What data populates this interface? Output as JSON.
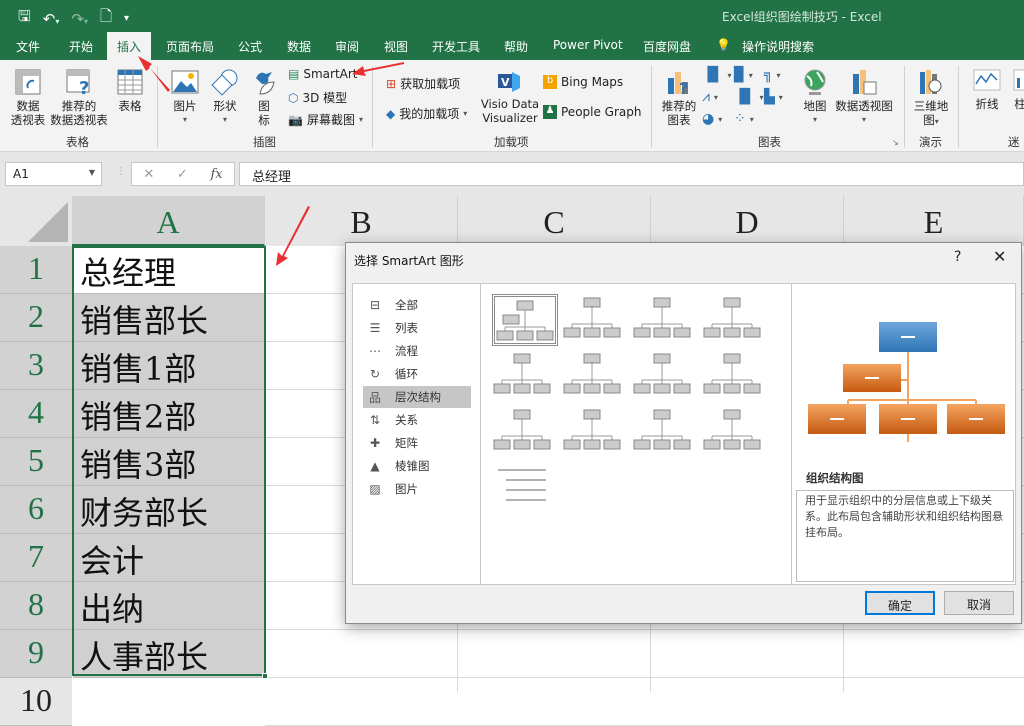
{
  "window": {
    "title": "Excel组织图绘制技巧  -  Excel"
  },
  "qat": {
    "save": "save-icon",
    "undo": "undo-icon",
    "redo": "redo-icon",
    "preview": "print-preview-icon",
    "customize": "customize-icon"
  },
  "tabs": [
    "文件",
    "开始",
    "插入",
    "页面布局",
    "公式",
    "数据",
    "审阅",
    "视图",
    "开发工具",
    "帮助",
    "Power Pivot",
    "百度网盘"
  ],
  "active_tab": "插入",
  "tell_me": "操作说明搜索",
  "ribbon": {
    "tables": {
      "label": "表格",
      "pivot": "数据\n透视表",
      "pivot1": "数据",
      "pivot2": "透视表",
      "recpivot1": "推荐的",
      "recpivot2": "数据透视表",
      "table": "表格"
    },
    "illustrations": {
      "label": "插图",
      "pictures": "图片",
      "shapes": "形状",
      "icons1": "图",
      "icons2": "标",
      "smartart": "SmartArt",
      "model3d": "3D 模型",
      "screenshot": "屏幕截图"
    },
    "addins": {
      "label": "加载项",
      "get": "获取加载项",
      "my": "我的加载项",
      "visio1": "Visio Data",
      "visio2": "Visualizer",
      "bing": "Bing Maps",
      "people": "People Graph"
    },
    "charts": {
      "label": "图表",
      "rec1": "推荐的",
      "rec2": "图表",
      "map": "地图",
      "pivotchart": "数据透视图"
    },
    "tours": {
      "label": "演示",
      "map3d1": "三维地",
      "map3d2": "图"
    },
    "sparklines": {
      "label": "迷你",
      "line": "折线",
      "column": "柱"
    }
  },
  "formula_bar": {
    "name_box": "A1",
    "cancel": "✕",
    "enter": "✓",
    "fx": "fx",
    "value": "总经理"
  },
  "sheet": {
    "columns": [
      "A",
      "B",
      "C",
      "D",
      "E"
    ],
    "rows": [
      "1",
      "2",
      "3",
      "4",
      "5",
      "6",
      "7",
      "8",
      "9",
      "10"
    ],
    "cells": [
      "总经理",
      "销售部长",
      "销售1部",
      "销售2部",
      "销售3部",
      "财务部长",
      "会计",
      "出纳",
      "人事部长"
    ]
  },
  "dialog": {
    "title": "选择 SmartArt 图形",
    "help": "?",
    "close": "✕",
    "categories": [
      {
        "label": "全部",
        "icon": "all-icon"
      },
      {
        "label": "列表",
        "icon": "list-icon"
      },
      {
        "label": "流程",
        "icon": "process-icon"
      },
      {
        "label": "循环",
        "icon": "cycle-icon"
      },
      {
        "label": "层次结构",
        "icon": "hierarchy-icon"
      },
      {
        "label": "关系",
        "icon": "relationship-icon"
      },
      {
        "label": "矩阵",
        "icon": "matrix-icon"
      },
      {
        "label": "棱锥图",
        "icon": "pyramid-icon"
      },
      {
        "label": "图片",
        "icon": "picture-icon"
      }
    ],
    "selected_category": "层次结构",
    "selected_layout": "组织结构图",
    "layout_count": 13,
    "preview_name": "组织结构图",
    "preview_desc": "用于显示组织中的分层信息或上下级关系。此布局包含辅助形状和组织结构图悬挂布局。",
    "ok": "确定",
    "cancel": "取消",
    "colors": {
      "top": "#2e75b6",
      "node": "#e46c1f"
    }
  },
  "accent": "#217346"
}
